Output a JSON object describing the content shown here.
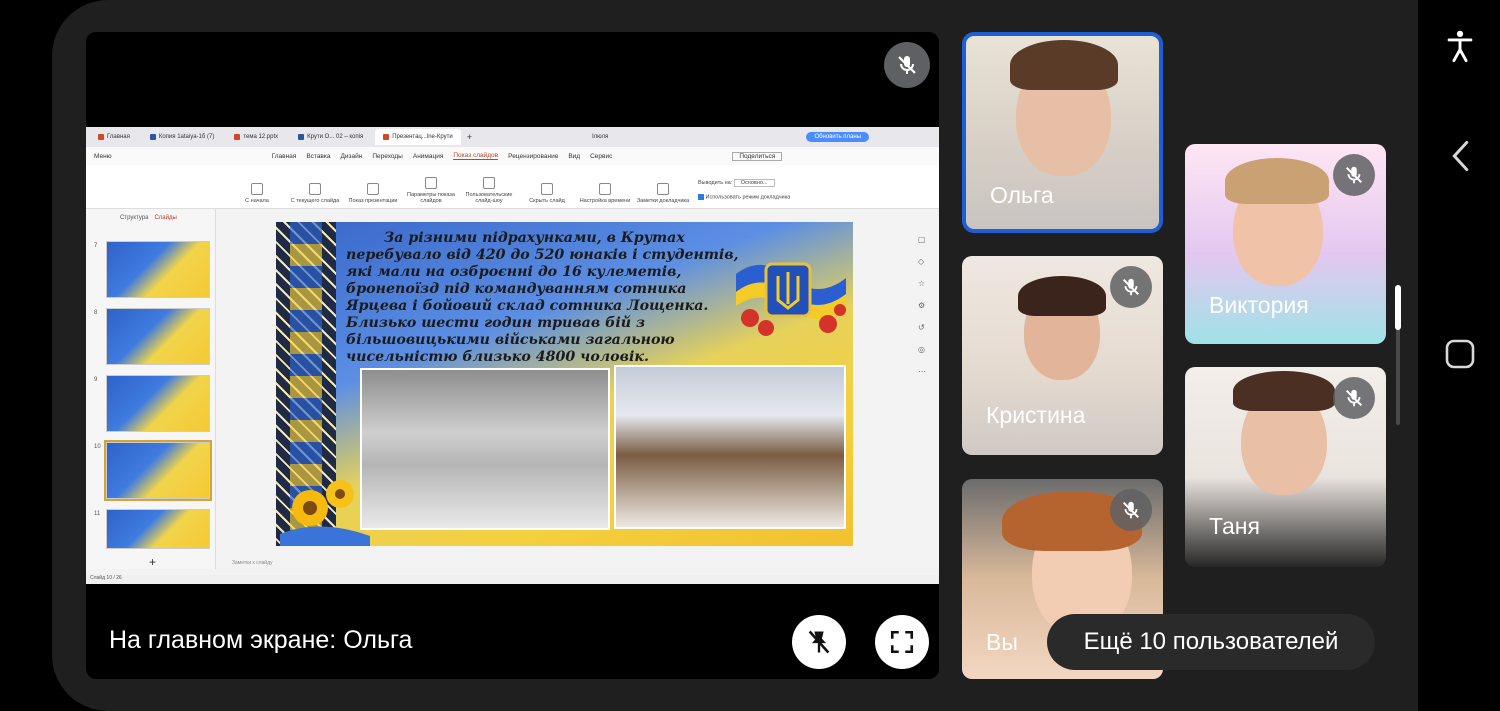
{
  "stage": {
    "caption": "На главном экране: Ольга"
  },
  "presentation": {
    "tabs": [
      "Главная",
      "Копия 1ataiya-1б (7)",
      "тема 12.pptx",
      "Крути О... 02 – копія",
      "Презентац...lne-Крути"
    ],
    "user": "Ілюля",
    "share_button": "Обновить планы",
    "menu": [
      "Меню",
      "Главная",
      "Вставка",
      "Дизайн",
      "Переходы",
      "Анимация",
      "Показ слайдов",
      "Рецензирование",
      "Вид",
      "Сервис"
    ],
    "share_label": "Поделиться",
    "ribbon": [
      "С начала",
      "С текущего слайда",
      "Показ презентации",
      "Параметры показа слайдов",
      "Пользовательские слайд-шоу",
      "Скрыть слайд",
      "Настройка времени",
      "Заметки докладчика"
    ],
    "output_label": "Выводить на:",
    "output_value": "Основно...",
    "presenter_label": "Использовать режим докладчика",
    "side_tabs": [
      "Структура",
      "Слайды"
    ],
    "slide_numbers": [
      "7",
      "8",
      "9",
      "10",
      "11"
    ],
    "notes_placeholder": "Заметки к слайду",
    "status": "Слайд 10 / 26",
    "slide_text": "За різними підрахунками, в Крутах перебувало від 420 до 520 юнаків і студентів, які мали на озброєнні до 16 кулеметів, бронепоїзд під командуванням сотника Ярцева і бойовий склад сотника Лощенка. Близько шести годин тривав бій з більшовицькими військами загальною чисельністю близько 4800 чоловік."
  },
  "participants": [
    {
      "name": "Ольга",
      "muted": false
    },
    {
      "name": "Кристина",
      "muted": true
    },
    {
      "name": "Вы",
      "muted": true
    },
    {
      "name": "Виктория",
      "muted": true
    },
    {
      "name": "Таня",
      "muted": true
    }
  ],
  "more_participants": "Ещё 10 пользователей",
  "colors": {
    "active_border": "#1f5fd6",
    "tile_background": "#1f1f20"
  },
  "icons": {
    "stage_mic": "mic-off-icon",
    "unpin": "unpin-icon",
    "fullscreen": "fullscreen-icon",
    "accessibility": "accessibility-icon",
    "back": "back-chevron-icon",
    "home": "home-square-icon"
  }
}
